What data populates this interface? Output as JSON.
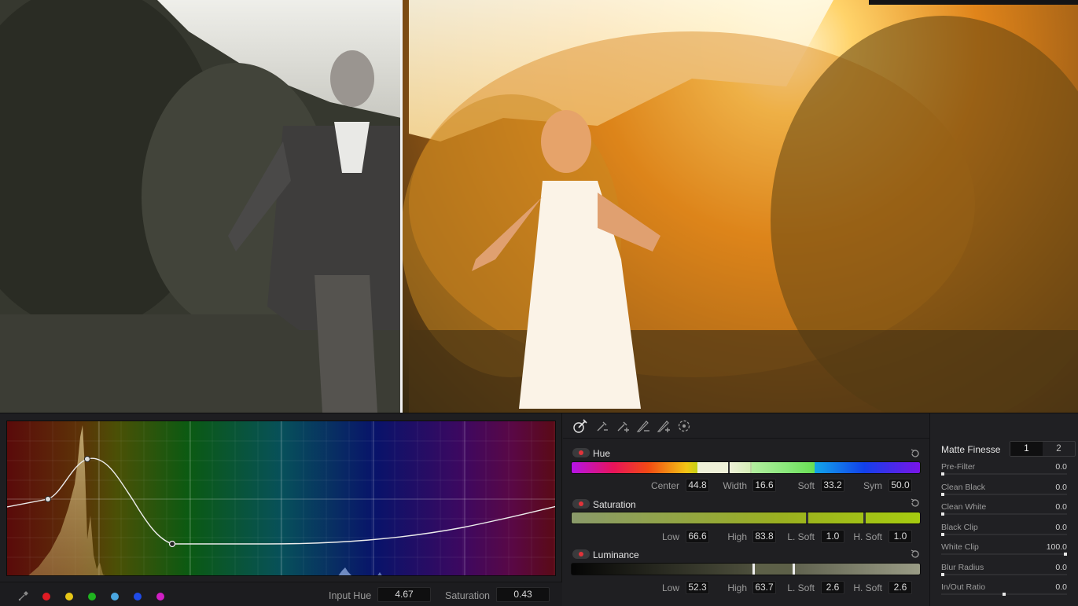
{
  "toolbar_icons": [
    "picker-icon",
    "picker-minus-icon",
    "picker-plus-icon",
    "feather-minus-icon",
    "feather-plus-icon",
    "invert-icon"
  ],
  "curve": {
    "swatches": [
      {
        "name": "red",
        "color": "#e01b24"
      },
      {
        "name": "yellow",
        "color": "#e6c617"
      },
      {
        "name": "green",
        "color": "#1fb31f"
      },
      {
        "name": "cyan",
        "color": "#4aa6e0"
      },
      {
        "name": "blue",
        "color": "#1f4be8"
      },
      {
        "name": "magenta",
        "color": "#d01fc4"
      }
    ],
    "input_hue_label": "Input Hue",
    "input_hue_value": "4.67",
    "saturation_label": "Saturation",
    "saturation_value": "0.43"
  },
  "qualifier": {
    "hue": {
      "title": "Hue",
      "center_label": "Center",
      "center_value": "44.8",
      "width_label": "Width",
      "width_value": "16.6",
      "soft_label": "Soft",
      "soft_value": "33.2",
      "sym_label": "Sym",
      "sym_value": "50.0"
    },
    "saturation": {
      "title": "Saturation",
      "low_label": "Low",
      "low_value": "66.6",
      "high_label": "High",
      "high_value": "83.8",
      "lsoft_label": "L. Soft",
      "lsoft_value": "1.0",
      "hsoft_label": "H. Soft",
      "hsoft_value": "1.0"
    },
    "luminance": {
      "title": "Luminance",
      "low_label": "Low",
      "low_value": "52.3",
      "high_label": "High",
      "high_value": "63.7",
      "lsoft_label": "L. Soft",
      "lsoft_value": "2.6",
      "hsoft_label": "H. Soft",
      "hsoft_value": "2.6"
    }
  },
  "matte": {
    "title": "Matte Finesse",
    "tabs": [
      "1",
      "2"
    ],
    "rows": [
      {
        "label": "Pre-Filter",
        "value": "0.0",
        "level": 0.0
      },
      {
        "label": "Clean Black",
        "value": "0.0",
        "level": 0.0
      },
      {
        "label": "Clean White",
        "value": "0.0",
        "level": 0.0
      },
      {
        "label": "Black Clip",
        "value": "0.0",
        "level": 0.0
      },
      {
        "label": "White Clip",
        "value": "100.0",
        "level": 1.0
      },
      {
        "label": "Blur Radius",
        "value": "0.0",
        "level": 0.0
      },
      {
        "label": "In/Out Ratio",
        "value": "0.0",
        "level": 0.5
      }
    ]
  }
}
